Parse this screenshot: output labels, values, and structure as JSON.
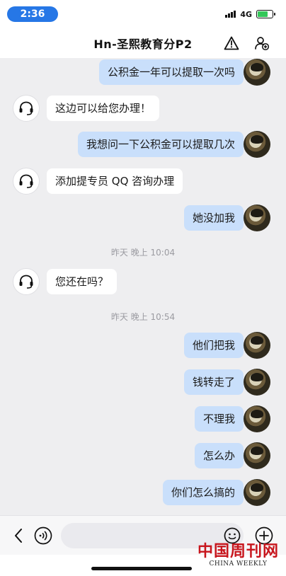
{
  "status_bar": {
    "time": "2:36",
    "network": "4G",
    "battery_level": 0.7
  },
  "header": {
    "title": "Hn-圣熙教育分P2",
    "icons": [
      "warning-icon",
      "add-contact-icon"
    ]
  },
  "messages": [
    {
      "sender": "user",
      "text": "公积金一年可以提取一次吗"
    },
    {
      "sender": "agent",
      "text": "这边可以给您办理！"
    },
    {
      "sender": "user",
      "text": "我想问一下公积金可以提取几次"
    },
    {
      "sender": "agent",
      "text": "添加提专员 QQ 咨询办理"
    },
    {
      "sender": "user",
      "text": "她没加我"
    },
    {
      "timestamp": "昨天 晚上 10:04"
    },
    {
      "sender": "agent",
      "text": "您还在吗？"
    },
    {
      "timestamp": "昨天 晚上 10:54"
    },
    {
      "sender": "user",
      "text": "他们把我"
    },
    {
      "sender": "user",
      "text": "钱转走了"
    },
    {
      "sender": "user",
      "text": "不理我"
    },
    {
      "sender": "user",
      "text": "怎么办"
    },
    {
      "sender": "user",
      "text": "你们怎么搞的"
    }
  ],
  "input_bar": {
    "placeholder": "",
    "icons": [
      "back-icon",
      "voice-icon",
      "emoji-icon",
      "plus-icon"
    ]
  },
  "watermark": {
    "cn": "中国周刊网",
    "en": "CHINA WEEKLY"
  },
  "colors": {
    "accent": "#2677e6",
    "outgoing_bubble": "#c9dffb",
    "incoming_bubble": "#ffffff",
    "chat_background": "#eeeef0",
    "watermark_red": "#c8161d"
  }
}
